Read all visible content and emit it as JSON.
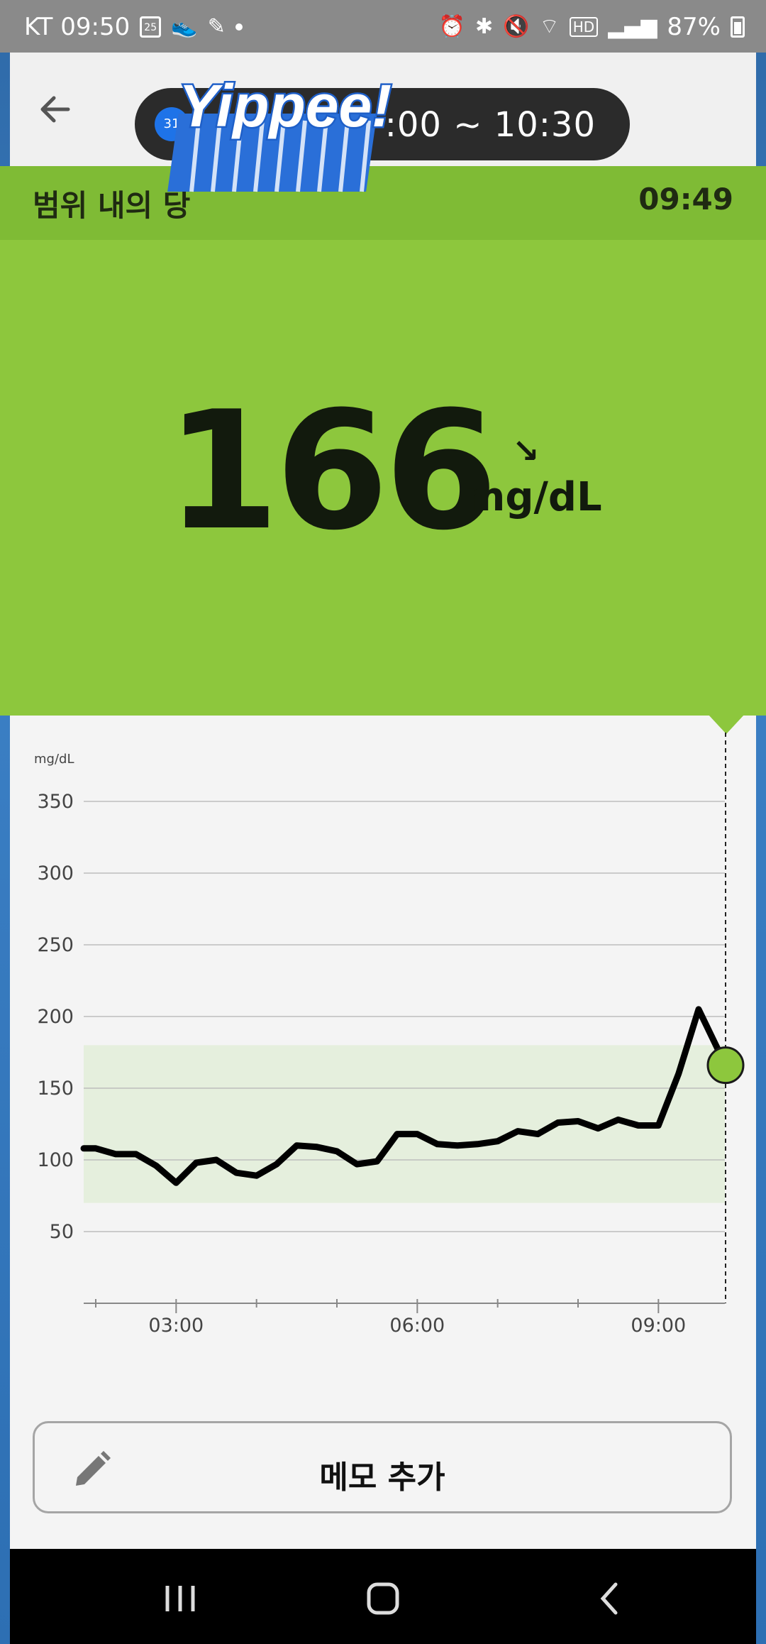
{
  "status_bar": {
    "carrier_time": "KT 09:50",
    "calendar_day": "25",
    "battery": "87%"
  },
  "header": {
    "calendar_badge": "31",
    "time_range": ":00 ~ 10:30",
    "sticker_text": "Yippee!"
  },
  "range_bar": {
    "label": "범위 내의 당",
    "time": "09:49"
  },
  "reading": {
    "value": "166",
    "unit": "mg/dL",
    "trend_arrow": "↘"
  },
  "colors": {
    "green": "#8dc73d",
    "green_dark": "#7fbb35",
    "target_band": "#e5efdd"
  },
  "chart_data": {
    "type": "line",
    "ylabel": "mg/dL",
    "ylim": [
      0,
      370
    ],
    "y_ticks": [
      350,
      300,
      250,
      200,
      150,
      100,
      50
    ],
    "x_tick_labels": [
      "03:00",
      "06:00",
      "09:00"
    ],
    "target_range": [
      70,
      180
    ],
    "series": [
      {
        "values": [
          {
            "t": "01:50",
            "v": 108
          },
          {
            "t": "02:00",
            "v": 108
          },
          {
            "t": "02:15",
            "v": 104
          },
          {
            "t": "02:30",
            "v": 104
          },
          {
            "t": "02:45",
            "v": 96
          },
          {
            "t": "03:00",
            "v": 84
          },
          {
            "t": "03:15",
            "v": 98
          },
          {
            "t": "03:30",
            "v": 100
          },
          {
            "t": "03:45",
            "v": 91
          },
          {
            "t": "04:00",
            "v": 89
          },
          {
            "t": "04:15",
            "v": 97
          },
          {
            "t": "04:30",
            "v": 110
          },
          {
            "t": "04:45",
            "v": 109
          },
          {
            "t": "05:00",
            "v": 106
          },
          {
            "t": "05:15",
            "v": 97
          },
          {
            "t": "05:30",
            "v": 99
          },
          {
            "t": "05:45",
            "v": 118
          },
          {
            "t": "06:00",
            "v": 118
          },
          {
            "t": "06:15",
            "v": 111
          },
          {
            "t": "06:30",
            "v": 110
          },
          {
            "t": "06:45",
            "v": 111
          },
          {
            "t": "07:00",
            "v": 113
          },
          {
            "t": "07:15",
            "v": 120
          },
          {
            "t": "07:30",
            "v": 118
          },
          {
            "t": "07:45",
            "v": 126
          },
          {
            "t": "08:00",
            "v": 127
          },
          {
            "t": "08:15",
            "v": 122
          },
          {
            "t": "08:30",
            "v": 128
          },
          {
            "t": "08:45",
            "v": 124
          },
          {
            "t": "09:00",
            "v": 124
          },
          {
            "t": "09:15",
            "v": 160
          },
          {
            "t": "09:30",
            "v": 205
          },
          {
            "t": "09:49",
            "v": 166
          }
        ]
      }
    ],
    "current_point": {
      "t": "09:49",
      "v": 166
    }
  },
  "memo": {
    "label": "메모 추가"
  }
}
